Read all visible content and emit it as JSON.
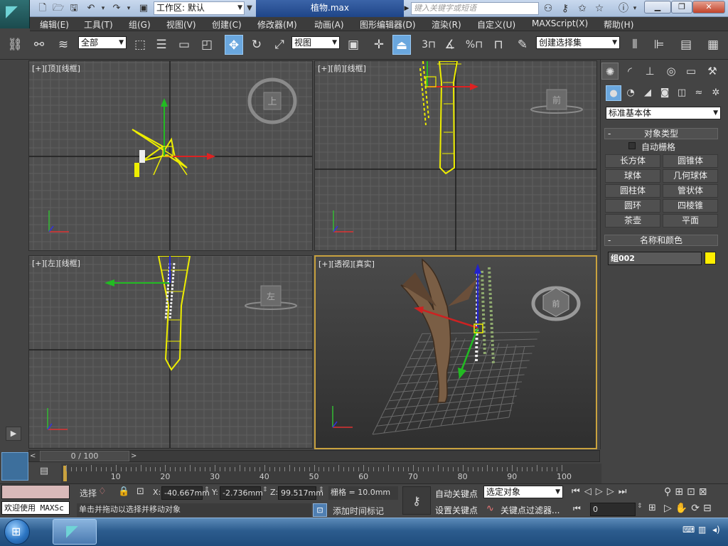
{
  "title": {
    "workspace_label": "工作区: 默认",
    "file_name": "植物.max",
    "search_placeholder": "键入关键字或短语"
  },
  "menu": [
    "编辑(E)",
    "工具(T)",
    "组(G)",
    "视图(V)",
    "创建(C)",
    "修改器(M)",
    "动画(A)",
    "图形编辑器(D)",
    "渲染(R)",
    "自定义(U)",
    "MAXScript(X)",
    "帮助(H)"
  ],
  "toolbar": {
    "selection_filter": "全部",
    "ref_coord": "视图",
    "named_selection": "创建选择集",
    "snap_label": "3",
    "angle_snap_label": "%"
  },
  "viewports": [
    {
      "label": "[+][顶][线框]",
      "cube_text": "上"
    },
    {
      "label": "[+][前][线框]",
      "cube_text": "前"
    },
    {
      "label": "[+][左][线框]",
      "cube_text": "左"
    },
    {
      "label": "[+][透视][真实]",
      "cube_text": "前"
    }
  ],
  "command_panel": {
    "primitive_type": "标准基本体",
    "object_type_title": "对象类型",
    "autogrid_label": "自动栅格",
    "buttons": [
      "长方体",
      "圆锥体",
      "球体",
      "几何球体",
      "圆柱体",
      "管状体",
      "圆环",
      "四棱锥",
      "茶壶",
      "平面"
    ],
    "name_color_title": "名称和颜色",
    "object_name": "组002",
    "object_color": "#ffee00"
  },
  "timeline": {
    "frame_display": "0 / 100",
    "ticks": [
      "10",
      "20",
      "30",
      "40",
      "50",
      "60",
      "70",
      "80",
      "90",
      "100"
    ]
  },
  "status": {
    "welcome": "欢迎使用 MAXSc",
    "selected_label": "选择",
    "prompt": "单击并拖动以选择并移动对象",
    "x_label": "X:",
    "x_value": "-40.667mm",
    "y_label": "Y:",
    "y_value": "-2.736mm",
    "z_label": "Z:",
    "z_value": "99.517mm",
    "grid": "栅格 = 10.0mm",
    "add_time_tag": "添加时间标记",
    "auto_key": "自动关键点",
    "set_key": "设置关键点",
    "key_mode": "选定对象",
    "key_filters": "关键点过滤器...",
    "frame_value": "0"
  }
}
